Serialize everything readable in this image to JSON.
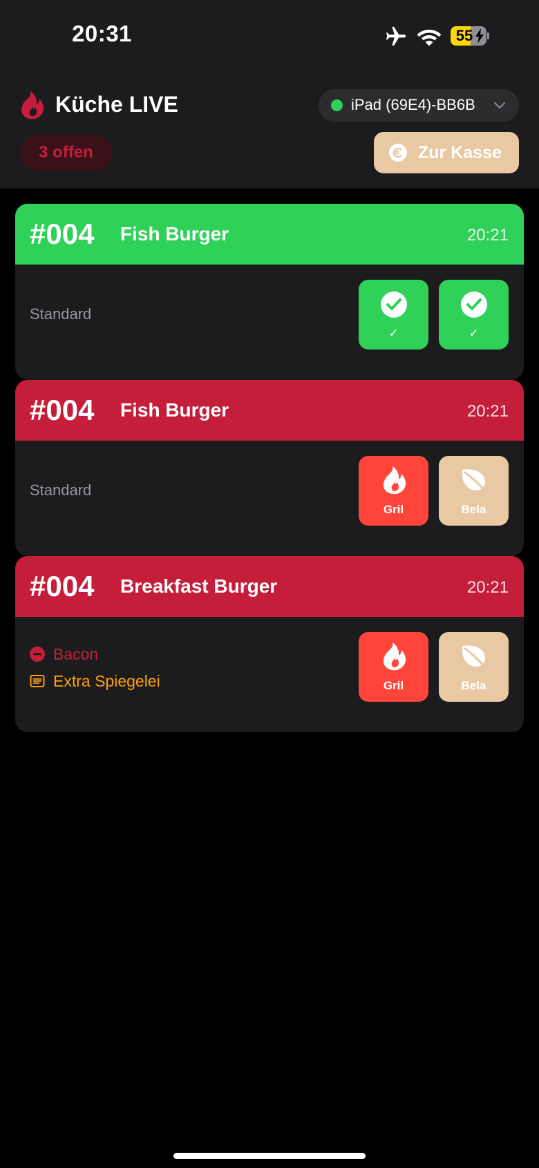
{
  "status_bar": {
    "time": "20:31",
    "battery_percent": "55",
    "battery_level": 0.55
  },
  "header": {
    "title": "Küche LIVE",
    "device": {
      "label": "iPad (69E4)-BB6B",
      "status_color": "#30d158"
    },
    "open_count_label": "3 offen",
    "checkout_label": "Zur Kasse"
  },
  "colors": {
    "ready": "#30d158",
    "pending": "#c41e3a",
    "grill": "#ff453a",
    "veg": "#e8c9a3"
  },
  "orders": [
    {
      "number": "#004",
      "item": "Fish Burger",
      "time": "20:21",
      "state": "ready",
      "note": "Standard",
      "stations": [
        {
          "label": "✓",
          "icon": "check-circle-icon"
        },
        {
          "label": "✓",
          "icon": "check-circle-icon"
        }
      ]
    },
    {
      "number": "#004",
      "item": "Fish Burger",
      "time": "20:21",
      "state": "pending",
      "note": "Standard",
      "stations": [
        {
          "label": "Gril",
          "icon": "flame-icon"
        },
        {
          "label": "Bela",
          "icon": "leaf-icon"
        }
      ]
    },
    {
      "number": "#004",
      "item": "Breakfast Burger",
      "time": "20:21",
      "state": "pending",
      "modifiers": [
        {
          "type": "remove",
          "text": "Bacon",
          "icon": "minus-circle-icon",
          "color": "#c41e3a"
        },
        {
          "type": "note",
          "text": "Extra Spiegelei",
          "icon": "note-icon",
          "color": "#ff9f0a"
        }
      ],
      "stations": [
        {
          "label": "Gril",
          "icon": "flame-icon"
        },
        {
          "label": "Bela",
          "icon": "leaf-icon"
        }
      ]
    }
  ]
}
